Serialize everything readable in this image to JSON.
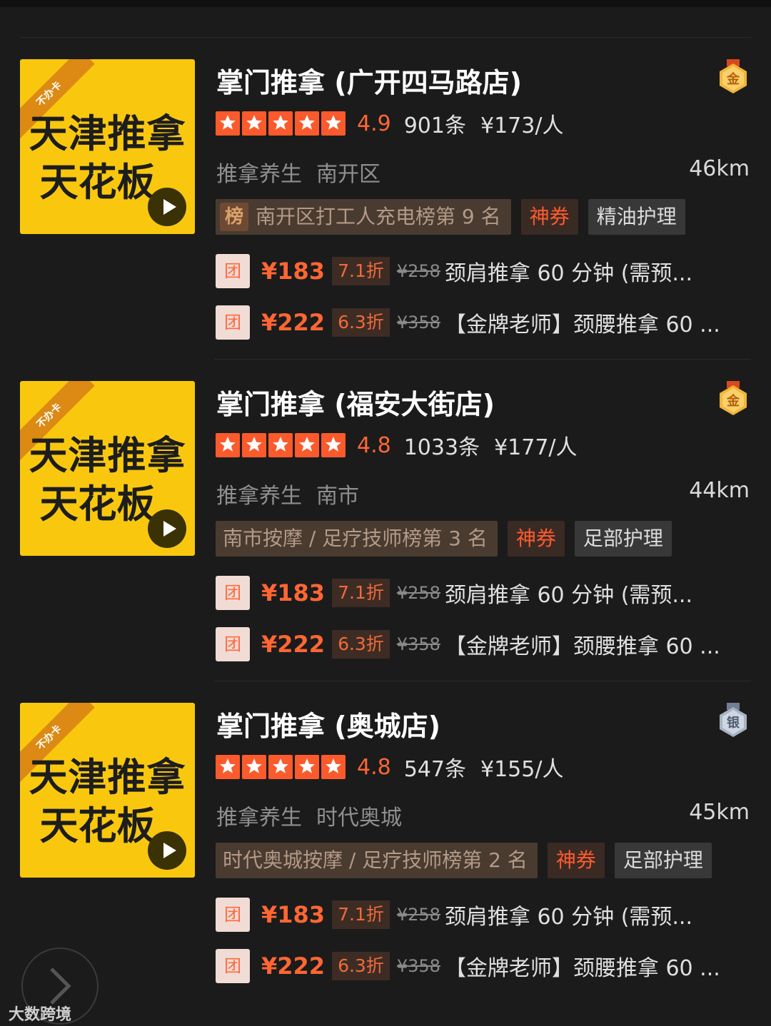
{
  "colors": {
    "background": "#1b1b1b",
    "accent": "#ff6633",
    "thumb": "#f9c80e"
  },
  "listings": [
    {
      "thumb": {
        "ribbon": "不办卡",
        "line1": "天津推拿",
        "line2": "天花板"
      },
      "title": "掌门推拿 (广开四马路店)",
      "medal": {
        "label": "金",
        "color": "gold"
      },
      "rating": "4.9",
      "reviews": "901条",
      "price": "¥173/人",
      "category": "推拿养生",
      "area": "南开区",
      "distance": "46km",
      "rank_icon": "榜",
      "rank": "南开区打工人充电榜第 9 名",
      "coupon": "神券",
      "service": "精油护理",
      "deals": [
        {
          "icon": "团",
          "price": "¥183",
          "discount": "7.1折",
          "original": "¥258",
          "name": "颈肩推拿 60 分钟 (需预..."
        },
        {
          "icon": "团",
          "price": "¥222",
          "discount": "6.3折",
          "original": "¥358",
          "name": "【金牌老师】颈腰推拿 60 ..."
        }
      ]
    },
    {
      "thumb": {
        "ribbon": "不办卡",
        "line1": "天津推拿",
        "line2": "天花板"
      },
      "title": "掌门推拿 (福安大街店)",
      "medal": {
        "label": "金",
        "color": "gold"
      },
      "rating": "4.8",
      "reviews": "1033条",
      "price": "¥177/人",
      "category": "推拿养生",
      "area": "南市",
      "distance": "44km",
      "rank_icon": "",
      "rank": "南市按摩 / 足疗技师榜第 3 名",
      "coupon": "神券",
      "service": "足部护理",
      "deals": [
        {
          "icon": "团",
          "price": "¥183",
          "discount": "7.1折",
          "original": "¥258",
          "name": "颈肩推拿 60 分钟 (需预..."
        },
        {
          "icon": "团",
          "price": "¥222",
          "discount": "6.3折",
          "original": "¥358",
          "name": "【金牌老师】颈腰推拿 60 ..."
        }
      ]
    },
    {
      "thumb": {
        "ribbon": "不办卡",
        "line1": "天津推拿",
        "line2": "天花板"
      },
      "title": "掌门推拿 (奥城店)",
      "medal": {
        "label": "银",
        "color": "silver"
      },
      "rating": "4.8",
      "reviews": "547条",
      "price": "¥155/人",
      "category": "推拿养生",
      "area": "时代奥城",
      "distance": "45km",
      "rank_icon": "",
      "rank": "时代奥城按摩 / 足疗技师榜第 2 名",
      "coupon": "神券",
      "service": "足部护理",
      "deals": [
        {
          "icon": "团",
          "price": "¥183",
          "discount": "7.1折",
          "original": "¥258",
          "name": "颈肩推拿 60 分钟 (需预..."
        },
        {
          "icon": "团",
          "price": "¥222",
          "discount": "6.3折",
          "original": "¥358",
          "name": "【金牌老师】颈腰推拿 60 ..."
        }
      ]
    }
  ],
  "watermark": "大数跨境"
}
